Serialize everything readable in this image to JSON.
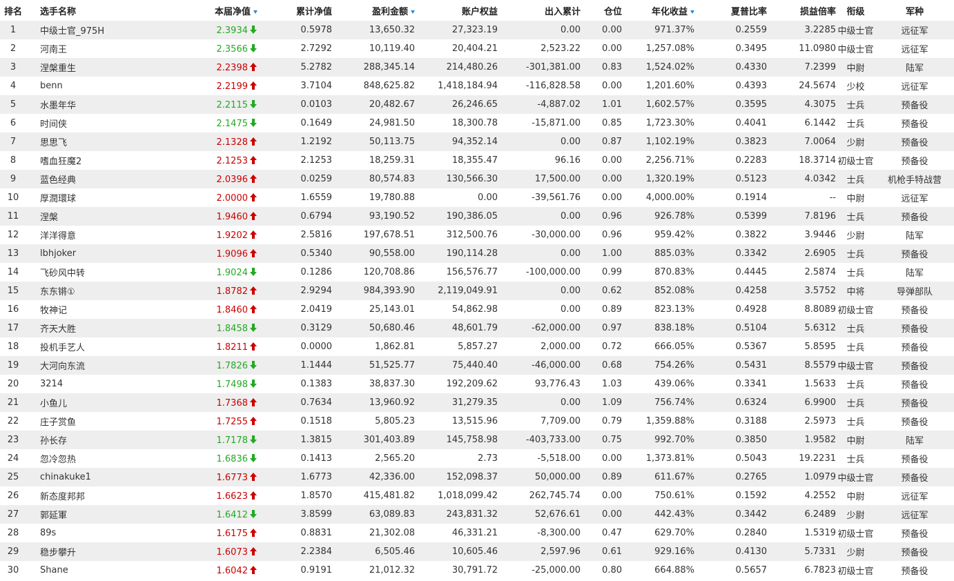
{
  "colors": {
    "up": "#cc0000",
    "down": "#22aa22",
    "sort_indicator": "#2a8ad4",
    "row_stripe": "#eeeeee"
  },
  "icons": {
    "up": "red-up-arrow-icon",
    "down": "green-down-arrow-icon",
    "sort": "sort-desc-triangle-icon"
  },
  "headers": {
    "rank": "排名",
    "name": "选手名称",
    "current_nav": "本届净值",
    "cum_nav": "累计净值",
    "profit": "盈利金额",
    "equity": "账户权益",
    "inout": "出入累计",
    "position": "仓位",
    "annual": "年化收益",
    "sharpe": "夏普比率",
    "pl_ratio": "损益倍率",
    "rank_title": "衔级",
    "army": "军种"
  },
  "rows": [
    {
      "rank": "1",
      "name": "中级士官_975H",
      "nav": "2.3934",
      "dir": "down",
      "cum_nav": "0.5978",
      "profit": "13,650.32",
      "equity": "27,323.19",
      "inout": "0.00",
      "position": "0.00",
      "annual": "971.37%",
      "sharpe": "0.2559",
      "pl_ratio": "3.2285",
      "title": "中级士官",
      "army": "远征军"
    },
    {
      "rank": "2",
      "name": "河南王",
      "nav": "2.3566",
      "dir": "down",
      "cum_nav": "2.7292",
      "profit": "10,119.40",
      "equity": "20,404.21",
      "inout": "2,523.22",
      "position": "0.00",
      "annual": "1,257.08%",
      "sharpe": "0.3495",
      "pl_ratio": "11.0980",
      "title": "中级士官",
      "army": "远征军"
    },
    {
      "rank": "3",
      "name": "涅槃重生",
      "nav": "2.2398",
      "dir": "up",
      "cum_nav": "5.2782",
      "profit": "288,345.14",
      "equity": "214,480.26",
      "inout": "-301,381.00",
      "position": "0.83",
      "annual": "1,524.02%",
      "sharpe": "0.4330",
      "pl_ratio": "7.2399",
      "title": "中尉",
      "army": "陆军"
    },
    {
      "rank": "4",
      "name": "benn",
      "nav": "2.2199",
      "dir": "up",
      "cum_nav": "3.7104",
      "profit": "848,625.82",
      "equity": "1,418,184.94",
      "inout": "-116,828.58",
      "position": "0.00",
      "annual": "1,201.60%",
      "sharpe": "0.4393",
      "pl_ratio": "24.5674",
      "title": "少校",
      "army": "远征军"
    },
    {
      "rank": "5",
      "name": "水墨年华",
      "nav": "2.2115",
      "dir": "down",
      "cum_nav": "0.0103",
      "profit": "20,482.67",
      "equity": "26,246.65",
      "inout": "-4,887.02",
      "position": "1.01",
      "annual": "1,602.57%",
      "sharpe": "0.3595",
      "pl_ratio": "4.3075",
      "title": "士兵",
      "army": "预备役"
    },
    {
      "rank": "6",
      "name": "时间侠",
      "nav": "2.1475",
      "dir": "down",
      "cum_nav": "0.1649",
      "profit": "24,981.50",
      "equity": "18,300.78",
      "inout": "-15,871.00",
      "position": "0.85",
      "annual": "1,723.30%",
      "sharpe": "0.4041",
      "pl_ratio": "6.1442",
      "title": "士兵",
      "army": "预备役"
    },
    {
      "rank": "7",
      "name": "思思飞",
      "nav": "2.1328",
      "dir": "up",
      "cum_nav": "1.2192",
      "profit": "50,113.75",
      "equity": "94,352.14",
      "inout": "0.00",
      "position": "0.87",
      "annual": "1,102.19%",
      "sharpe": "0.3823",
      "pl_ratio": "7.0064",
      "title": "少尉",
      "army": "预备役"
    },
    {
      "rank": "8",
      "name": "嗜血狂魔2",
      "nav": "2.1253",
      "dir": "up",
      "cum_nav": "2.1253",
      "profit": "18,259.31",
      "equity": "18,355.47",
      "inout": "96.16",
      "position": "0.00",
      "annual": "2,256.71%",
      "sharpe": "0.2283",
      "pl_ratio": "18.3714",
      "title": "初级士官",
      "army": "预备役"
    },
    {
      "rank": "9",
      "name": "蓝色经典",
      "nav": "2.0396",
      "dir": "up",
      "cum_nav": "0.0259",
      "profit": "80,574.83",
      "equity": "130,566.30",
      "inout": "17,500.00",
      "position": "0.00",
      "annual": "1,320.19%",
      "sharpe": "0.5123",
      "pl_ratio": "4.0342",
      "title": "士兵",
      "army": "机枪手特战营"
    },
    {
      "rank": "10",
      "name": "厚潤環球",
      "nav": "2.0000",
      "dir": "up",
      "cum_nav": "1.6559",
      "profit": "19,780.88",
      "equity": "0.00",
      "inout": "-39,561.76",
      "position": "0.00",
      "annual": "4,000.00%",
      "sharpe": "0.1914",
      "pl_ratio": "--",
      "title": "中尉",
      "army": "远征军"
    },
    {
      "rank": "11",
      "name": "涅槃",
      "nav": "1.9460",
      "dir": "up",
      "cum_nav": "0.6794",
      "profit": "93,190.52",
      "equity": "190,386.05",
      "inout": "0.00",
      "position": "0.96",
      "annual": "926.78%",
      "sharpe": "0.5399",
      "pl_ratio": "7.8196",
      "title": "士兵",
      "army": "预备役"
    },
    {
      "rank": "12",
      "name": "洋洋得意",
      "nav": "1.9202",
      "dir": "up",
      "cum_nav": "2.5816",
      "profit": "197,678.51",
      "equity": "312,500.76",
      "inout": "-30,000.00",
      "position": "0.96",
      "annual": "959.42%",
      "sharpe": "0.3822",
      "pl_ratio": "3.9446",
      "title": "少尉",
      "army": "陆军"
    },
    {
      "rank": "13",
      "name": "lbhjoker",
      "nav": "1.9096",
      "dir": "up",
      "cum_nav": "0.5340",
      "profit": "90,558.00",
      "equity": "190,114.28",
      "inout": "0.00",
      "position": "1.00",
      "annual": "885.03%",
      "sharpe": "0.3342",
      "pl_ratio": "2.6905",
      "title": "士兵",
      "army": "预备役"
    },
    {
      "rank": "14",
      "name": "飞砂风中转",
      "nav": "1.9024",
      "dir": "down",
      "cum_nav": "0.1286",
      "profit": "120,708.86",
      "equity": "156,576.77",
      "inout": "-100,000.00",
      "position": "0.99",
      "annual": "870.83%",
      "sharpe": "0.4445",
      "pl_ratio": "2.5874",
      "title": "士兵",
      "army": "陆军"
    },
    {
      "rank": "15",
      "name": "东东锵①",
      "nav": "1.8782",
      "dir": "up",
      "cum_nav": "2.9294",
      "profit": "984,393.90",
      "equity": "2,119,049.91",
      "inout": "0.00",
      "position": "0.62",
      "annual": "852.08%",
      "sharpe": "0.4258",
      "pl_ratio": "3.5752",
      "title": "中将",
      "army": "导弹部队"
    },
    {
      "rank": "16",
      "name": "牧神记",
      "nav": "1.8460",
      "dir": "up",
      "cum_nav": "2.0419",
      "profit": "25,143.01",
      "equity": "54,862.98",
      "inout": "0.00",
      "position": "0.89",
      "annual": "823.13%",
      "sharpe": "0.4928",
      "pl_ratio": "8.8089",
      "title": "初级士官",
      "army": "预备役"
    },
    {
      "rank": "17",
      "name": "齐天大胜",
      "nav": "1.8458",
      "dir": "down",
      "cum_nav": "0.3129",
      "profit": "50,680.46",
      "equity": "48,601.79",
      "inout": "-62,000.00",
      "position": "0.97",
      "annual": "838.18%",
      "sharpe": "0.5104",
      "pl_ratio": "5.6312",
      "title": "士兵",
      "army": "预备役"
    },
    {
      "rank": "18",
      "name": "投机手艺人",
      "nav": "1.8211",
      "dir": "up",
      "cum_nav": "0.0000",
      "profit": "1,862.81",
      "equity": "5,857.27",
      "inout": "2,000.00",
      "position": "0.72",
      "annual": "666.05%",
      "sharpe": "0.5367",
      "pl_ratio": "5.8595",
      "title": "士兵",
      "army": "预备役"
    },
    {
      "rank": "19",
      "name": "大河向东流",
      "nav": "1.7826",
      "dir": "down",
      "cum_nav": "1.1444",
      "profit": "51,525.77",
      "equity": "75,440.40",
      "inout": "-46,000.00",
      "position": "0.68",
      "annual": "754.26%",
      "sharpe": "0.5431",
      "pl_ratio": "8.5579",
      "title": "中级士官",
      "army": "预备役"
    },
    {
      "rank": "20",
      "name": "3214",
      "nav": "1.7498",
      "dir": "down",
      "cum_nav": "0.1383",
      "profit": "38,837.30",
      "equity": "192,209.62",
      "inout": "93,776.43",
      "position": "1.03",
      "annual": "439.06%",
      "sharpe": "0.3341",
      "pl_ratio": "1.5633",
      "title": "士兵",
      "army": "预备役"
    },
    {
      "rank": "21",
      "name": "小鱼儿",
      "nav": "1.7368",
      "dir": "up",
      "cum_nav": "0.7634",
      "profit": "13,960.92",
      "equity": "31,279.35",
      "inout": "0.00",
      "position": "1.09",
      "annual": "756.74%",
      "sharpe": "0.6324",
      "pl_ratio": "6.9900",
      "title": "士兵",
      "army": "预备役"
    },
    {
      "rank": "22",
      "name": "庄子赏鱼",
      "nav": "1.7255",
      "dir": "up",
      "cum_nav": "0.1518",
      "profit": "5,805.23",
      "equity": "13,515.96",
      "inout": "7,709.00",
      "position": "0.79",
      "annual": "1,359.88%",
      "sharpe": "0.3188",
      "pl_ratio": "2.5973",
      "title": "士兵",
      "army": "预备役"
    },
    {
      "rank": "23",
      "name": "孙长存",
      "nav": "1.7178",
      "dir": "down",
      "cum_nav": "1.3815",
      "profit": "301,403.89",
      "equity": "145,758.98",
      "inout": "-403,733.00",
      "position": "0.75",
      "annual": "992.70%",
      "sharpe": "0.3850",
      "pl_ratio": "1.9582",
      "title": "中尉",
      "army": "陆军"
    },
    {
      "rank": "24",
      "name": "忽冷忽热",
      "nav": "1.6836",
      "dir": "down",
      "cum_nav": "0.1413",
      "profit": "2,565.20",
      "equity": "2.73",
      "inout": "-5,518.00",
      "position": "0.00",
      "annual": "1,373.81%",
      "sharpe": "0.5043",
      "pl_ratio": "19.2231",
      "title": "士兵",
      "army": "预备役"
    },
    {
      "rank": "25",
      "name": "chinakuke1",
      "nav": "1.6773",
      "dir": "up",
      "cum_nav": "1.6773",
      "profit": "42,336.00",
      "equity": "152,098.37",
      "inout": "50,000.00",
      "position": "0.89",
      "annual": "611.67%",
      "sharpe": "0.2765",
      "pl_ratio": "1.0979",
      "title": "中级士官",
      "army": "预备役"
    },
    {
      "rank": "26",
      "name": "新态度邦邦",
      "nav": "1.6623",
      "dir": "up",
      "cum_nav": "1.8570",
      "profit": "415,481.82",
      "equity": "1,018,099.42",
      "inout": "262,745.74",
      "position": "0.00",
      "annual": "750.61%",
      "sharpe": "0.1592",
      "pl_ratio": "4.2552",
      "title": "中尉",
      "army": "远征军"
    },
    {
      "rank": "27",
      "name": "郭延軍",
      "nav": "1.6412",
      "dir": "down",
      "cum_nav": "3.8599",
      "profit": "63,089.83",
      "equity": "243,831.32",
      "inout": "52,676.61",
      "position": "0.00",
      "annual": "442.43%",
      "sharpe": "0.3442",
      "pl_ratio": "6.2489",
      "title": "少尉",
      "army": "远征军"
    },
    {
      "rank": "28",
      "name": "89s",
      "nav": "1.6175",
      "dir": "up",
      "cum_nav": "0.8831",
      "profit": "21,302.08",
      "equity": "46,331.21",
      "inout": "-8,300.00",
      "position": "0.47",
      "annual": "629.70%",
      "sharpe": "0.2840",
      "pl_ratio": "1.5319",
      "title": "初级士官",
      "army": "预备役"
    },
    {
      "rank": "29",
      "name": "稳步攀升",
      "nav": "1.6073",
      "dir": "up",
      "cum_nav": "2.2384",
      "profit": "6,505.46",
      "equity": "10,605.46",
      "inout": "2,597.96",
      "position": "0.61",
      "annual": "929.16%",
      "sharpe": "0.4130",
      "pl_ratio": "5.7331",
      "title": "少尉",
      "army": "预备役"
    },
    {
      "rank": "30",
      "name": "Shane",
      "nav": "1.6042",
      "dir": "up",
      "cum_nav": "0.9191",
      "profit": "21,012.32",
      "equity": "30,791.72",
      "inout": "-25,000.00",
      "position": "0.80",
      "annual": "664.88%",
      "sharpe": "0.5657",
      "pl_ratio": "6.7823",
      "title": "初级士官",
      "army": "预备役"
    }
  ]
}
